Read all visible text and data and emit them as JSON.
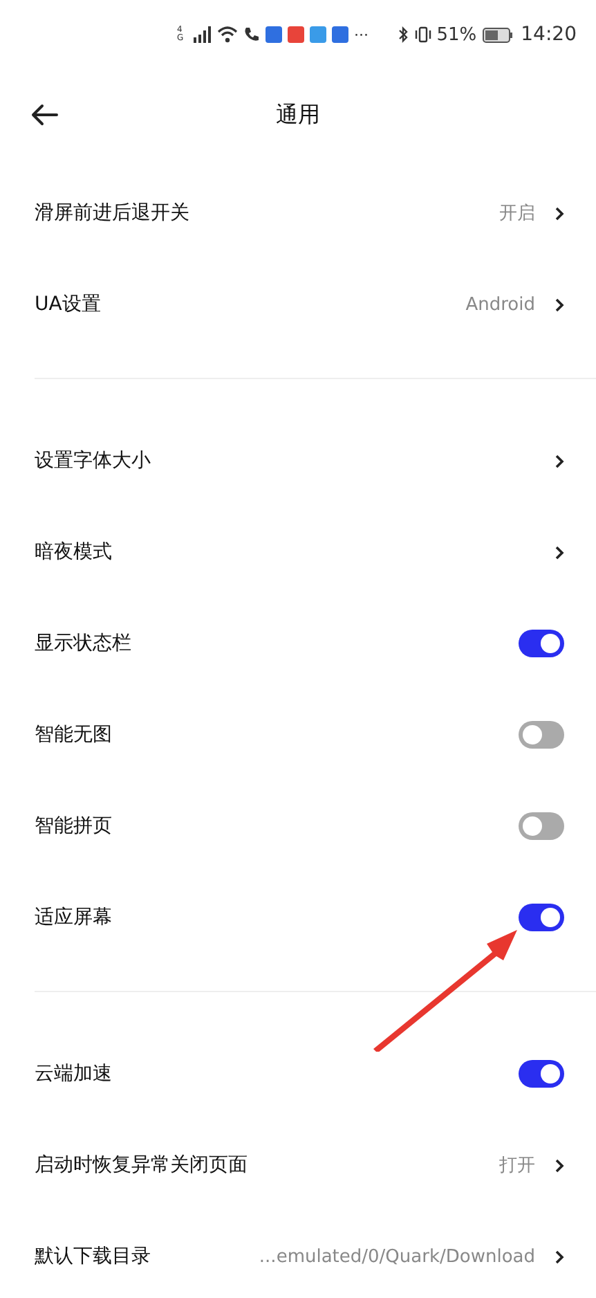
{
  "status_bar": {
    "network": "4G",
    "more": "···",
    "battery": "51%",
    "time": "14:20"
  },
  "header": {
    "title": "通用"
  },
  "sections": [
    {
      "rows": [
        {
          "kind": "value",
          "label": "滑屏前进后退开关",
          "value": "开启"
        },
        {
          "kind": "value",
          "label": "UA设置",
          "value": "Android"
        }
      ]
    },
    {
      "rows": [
        {
          "kind": "link",
          "label": "设置字体大小"
        },
        {
          "kind": "link",
          "label": "暗夜模式"
        },
        {
          "kind": "toggle",
          "label": "显示状态栏",
          "on": true
        },
        {
          "kind": "toggle",
          "label": "智能无图",
          "on": false
        },
        {
          "kind": "toggle",
          "label": "智能拼页",
          "on": false
        },
        {
          "kind": "toggle",
          "label": "适应屏幕",
          "on": true
        }
      ]
    },
    {
      "rows": [
        {
          "kind": "toggle",
          "label": "云端加速",
          "on": true
        },
        {
          "kind": "value",
          "label": "启动时恢复异常关闭页面",
          "value": "打开"
        },
        {
          "kind": "value",
          "label": "默认下载目录",
          "value": "...emulated/0/Quark/Download"
        }
      ]
    }
  ]
}
